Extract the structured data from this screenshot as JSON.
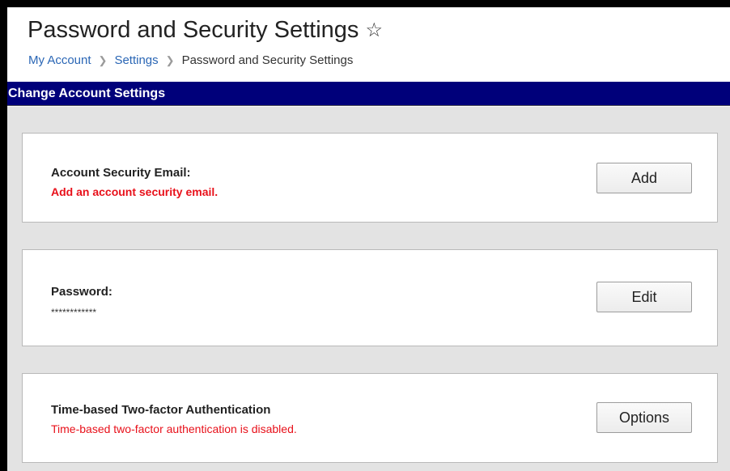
{
  "header": {
    "title": "Password and Security Settings",
    "favorite_icon": "star-outline-icon",
    "breadcrumb": [
      {
        "label": "My Account",
        "link": true
      },
      {
        "label": "Settings",
        "link": true
      },
      {
        "label": "Password and Security Settings",
        "link": false
      }
    ],
    "separator": ">"
  },
  "section": {
    "title": "Change Account Settings"
  },
  "settings": [
    {
      "title": "Account Security Email:",
      "status": "Add an account security email.",
      "button": "Add"
    },
    {
      "title": "Password:",
      "status": "************",
      "button": "Edit"
    },
    {
      "title": "Time-based Two-factor Authentication",
      "status": "Time-based two-factor authentication is disabled.",
      "button": "Options"
    }
  ],
  "colors": {
    "section_bar": "#00007a",
    "error_text": "#e8101a",
    "link": "#2a66b5",
    "content_bg": "#e3e3e3"
  }
}
